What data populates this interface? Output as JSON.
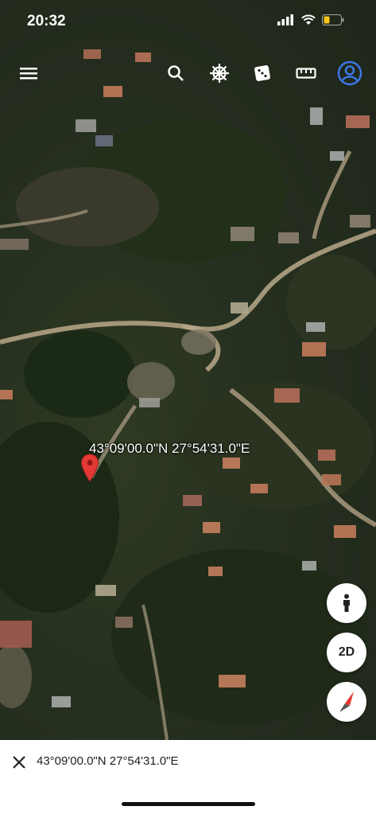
{
  "status_bar": {
    "time": "20:32"
  },
  "toolbar": {
    "icons": [
      "menu-icon",
      "search-icon",
      "ship-wheel-icon",
      "dice-icon",
      "ruler-icon",
      "account-icon"
    ]
  },
  "map": {
    "pin_label": "43°09'00.0\"N 27°54'31.0\"E",
    "controls": {
      "pegman": "person-icon",
      "view_toggle": "2D",
      "compass": "compass-icon"
    }
  },
  "bottom_panel": {
    "coordinates": "43°09'00.0\"N 27°54'31.0\"E",
    "close_icon": "close-icon"
  },
  "colors": {
    "pin": "#e53935",
    "account": "#3b78e7",
    "compass_red": "#e53935"
  }
}
